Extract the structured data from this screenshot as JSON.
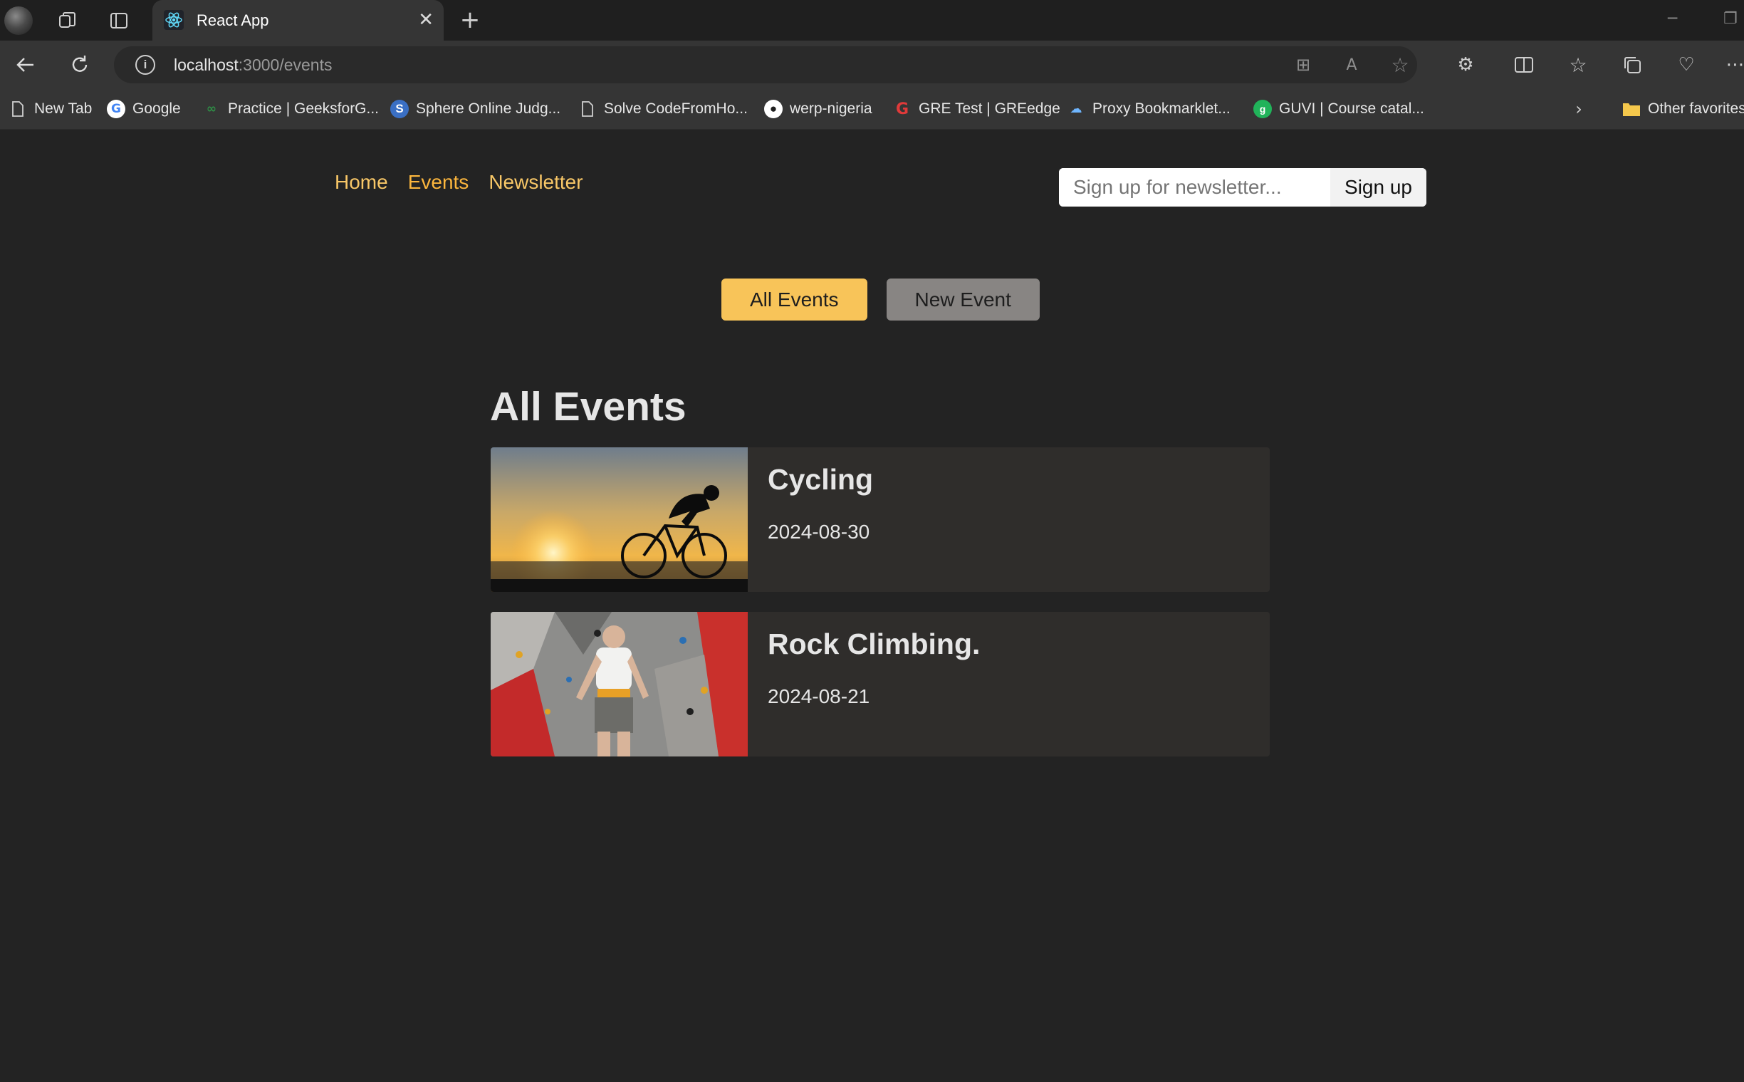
{
  "browser": {
    "tab_title": "React App",
    "url_host": "localhost",
    "url_path": ":3000/events",
    "bookmarks": [
      {
        "label": "New Tab",
        "icon": "page-icon"
      },
      {
        "label": "Google",
        "icon": "google-icon"
      },
      {
        "label": "Practice | GeeksforG...",
        "icon": "geeksforgeeks-icon"
      },
      {
        "label": "Sphere Online Judg...",
        "icon": "spoj-icon"
      },
      {
        "label": "Solve CodeFromHo...",
        "icon": "page-icon"
      },
      {
        "label": "werp-nigeria",
        "icon": "github-icon"
      },
      {
        "label": "GRE Test | GREedge",
        "icon": "greedge-icon"
      },
      {
        "label": "Proxy Bookmarklet...",
        "icon": "cloud-icon"
      },
      {
        "label": "GUVI | Course catal...",
        "icon": "guvi-icon"
      }
    ],
    "other_favorites": "Other favorites"
  },
  "nav": {
    "home": "Home",
    "events": "Events",
    "newsletter": "Newsletter"
  },
  "newsletter_form": {
    "placeholder": "Sign up for newsletter...",
    "button": "Sign up"
  },
  "actions": {
    "all_events": "All Events",
    "new_event": "New Event"
  },
  "page_title": "All Events",
  "events": [
    {
      "title": "Cycling",
      "date": "2024-08-30"
    },
    {
      "title": "Rock Climbing.",
      "date": "2024-08-21"
    }
  ],
  "colors": {
    "accent": "#f8c767",
    "nav_active": "#fcb63d",
    "primary_button": "#f8c459",
    "secondary_button": "#888583",
    "background": "#232323",
    "card": "#2f2d2b"
  }
}
